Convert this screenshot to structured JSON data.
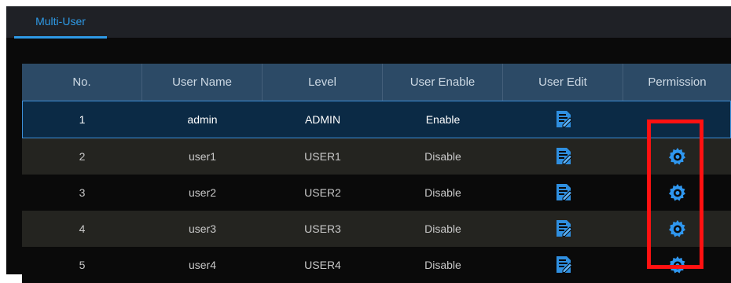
{
  "tabs": [
    {
      "label": "Multi-User",
      "active": true
    }
  ],
  "table": {
    "headers": [
      "No.",
      "User Name",
      "Level",
      "User Enable",
      "User Edit",
      "Permission"
    ],
    "rows": [
      {
        "no": "1",
        "user_name": "admin",
        "level": "ADMIN",
        "enable": "Enable",
        "edit_icon": "edit-icon",
        "permission_icon": null,
        "selected": true
      },
      {
        "no": "2",
        "user_name": "user1",
        "level": "USER1",
        "enable": "Disable",
        "edit_icon": "edit-icon",
        "permission_icon": "gear-icon",
        "selected": false
      },
      {
        "no": "3",
        "user_name": "user2",
        "level": "USER2",
        "enable": "Disable",
        "edit_icon": "edit-icon",
        "permission_icon": "gear-icon",
        "selected": false
      },
      {
        "no": "4",
        "user_name": "user3",
        "level": "USER3",
        "enable": "Disable",
        "edit_icon": "edit-icon",
        "permission_icon": "gear-icon",
        "selected": false
      },
      {
        "no": "5",
        "user_name": "user4",
        "level": "USER4",
        "enable": "Disable",
        "edit_icon": "edit-icon",
        "permission_icon": "gear-icon",
        "selected": false
      }
    ]
  },
  "colors": {
    "accent": "#2e9ae6",
    "header_bg": "#2c4a66",
    "selected_row_bg": "#0b2a45",
    "highlight_box": "#ff1111"
  }
}
